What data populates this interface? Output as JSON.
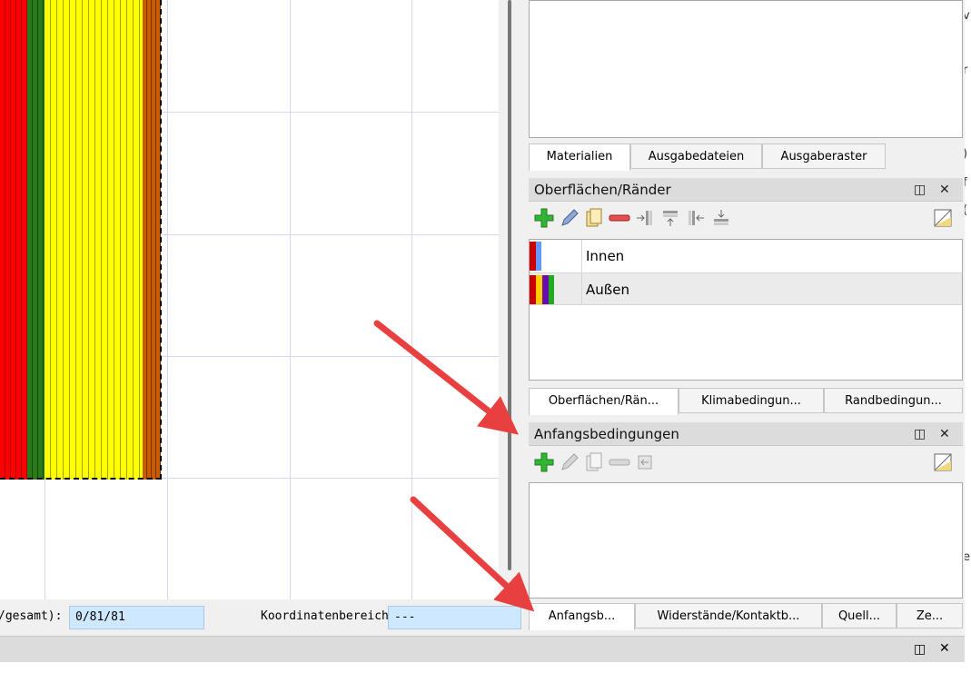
{
  "materials_panel": {
    "tabs": [
      "Materialien",
      "Ausgabedateien",
      "Ausgaberaster"
    ]
  },
  "surfaces_panel": {
    "title": "Oberflächen/Ränder",
    "float_icon": "restore-icon",
    "close_icon": "close-icon",
    "toolbar_icons": [
      "add-icon",
      "edit-icon",
      "copy-icon",
      "remove-icon",
      "assign-left-icon",
      "assign-top-icon",
      "assign-right-icon",
      "assign-bottom-icon",
      "toggle-edit-icon"
    ],
    "rows": [
      {
        "label": "Innen",
        "colors": [
          "#cc0000",
          "#6699ff"
        ]
      },
      {
        "label": "Außen",
        "colors": [
          "#cc0000",
          "#ffcc00",
          "#6a0dad",
          "#22aa22"
        ]
      }
    ],
    "tabs": [
      "Oberflächen/Rän...",
      "Klimabedingun...",
      "Randbedingun..."
    ]
  },
  "initial_conditions_panel": {
    "title": "Anfangsbedingungen",
    "toolbar_icons": [
      "add-icon",
      "edit-icon-disabled",
      "copy-icon-disabled",
      "remove-icon-disabled",
      "assign-icon-disabled",
      "toggle-edit-icon"
    ],
    "tabs": [
      "Anfangsb...",
      "Widerstände/Kontaktb...",
      "Quell...",
      "Ze..."
    ]
  },
  "status_bar": {
    "count_label": "/gesamt):",
    "count_value": "0/81/81",
    "coord_label": "Koordinatenbereich:",
    "coord_value": "---"
  },
  "far_right_letters": [
    "v",
    "r",
    ")",
    "f",
    "(",
    "e"
  ],
  "construction": {
    "layers": [
      {
        "color": "#ff0000"
      },
      {
        "color": "#2a7a1a"
      },
      {
        "color": "#ffff00"
      },
      {
        "color": "#c85a00"
      }
    ]
  },
  "annotations": {
    "arrow_color": "#e84040"
  }
}
